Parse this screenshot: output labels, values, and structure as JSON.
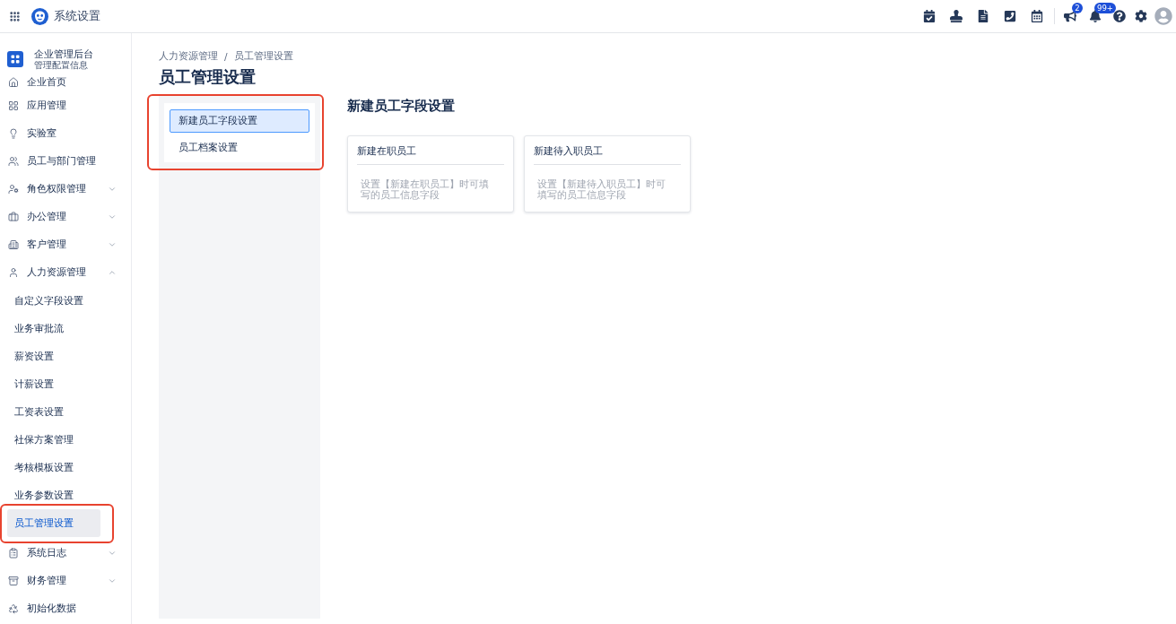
{
  "top_bar": {
    "title": "系统设置",
    "announcement_badge": "2",
    "notification_badge": "99+"
  },
  "sidebar": {
    "header": {
      "title": "企业管理后台",
      "subtitle": "管理配置信息"
    },
    "items": [
      {
        "kind": "link",
        "label": "企业首页"
      },
      {
        "kind": "link",
        "label": "应用管理"
      },
      {
        "kind": "link",
        "label": "实验室"
      },
      {
        "kind": "link",
        "label": "员工与部门管理"
      },
      {
        "kind": "group",
        "label": "角色权限管理",
        "expanded": false
      },
      {
        "kind": "group",
        "label": "办公管理",
        "expanded": false
      },
      {
        "kind": "group",
        "label": "客户管理",
        "expanded": false
      },
      {
        "kind": "group",
        "label": "人力资源管理",
        "expanded": true,
        "children": [
          {
            "label": "自定义字段设置",
            "selected": false,
            "highlighted": false
          },
          {
            "label": "业务审批流",
            "selected": false,
            "highlighted": false
          },
          {
            "label": "薪资设置",
            "selected": false,
            "highlighted": false
          },
          {
            "label": "计薪设置",
            "selected": false,
            "highlighted": false
          },
          {
            "label": "工资表设置",
            "selected": false,
            "highlighted": false
          },
          {
            "label": "社保方案管理",
            "selected": false,
            "highlighted": false
          },
          {
            "label": "考核模板设置",
            "selected": false,
            "highlighted": false
          },
          {
            "label": "业务参数设置",
            "selected": false,
            "highlighted": false
          },
          {
            "label": "员工管理设置",
            "selected": true,
            "highlighted": true
          }
        ]
      },
      {
        "kind": "group",
        "label": "系统日志",
        "expanded": false
      },
      {
        "kind": "group",
        "label": "财务管理",
        "expanded": false
      },
      {
        "kind": "link",
        "label": "初始化数据"
      }
    ]
  },
  "page": {
    "breadcrumb": [
      "人力资源管理",
      "员工管理设置"
    ],
    "breadcrumb_separator": "/",
    "title": "员工管理设置",
    "sub_nav": {
      "highlighted": true,
      "items": [
        {
          "label": "新建员工字段设置",
          "selected": true
        },
        {
          "label": "员工档案设置",
          "selected": false
        }
      ]
    },
    "section": {
      "title": "新建员工字段设置",
      "cards": [
        {
          "title": "新建在职员工",
          "description": "设置【新建在职员工】时可填写的员工信息字段"
        },
        {
          "title": "新建待入职员工",
          "description": "设置【新建待入职员工】时可填写的员工信息字段"
        }
      ]
    }
  }
}
